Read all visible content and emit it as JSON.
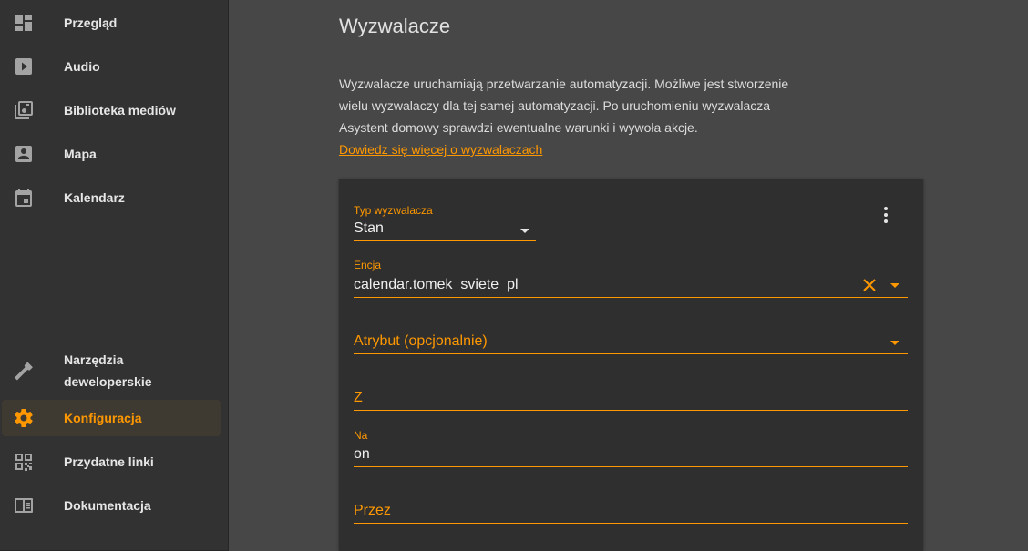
{
  "sidebar": {
    "items": [
      {
        "label": "Przegląd",
        "icon": "dashboard-icon",
        "active": false
      },
      {
        "label": "Audio",
        "icon": "play-box-icon",
        "active": false
      },
      {
        "label": "Biblioteka mediów",
        "icon": "music-library-icon",
        "active": false
      },
      {
        "label": "Mapa",
        "icon": "account-box-icon",
        "active": false
      },
      {
        "label": "Kalendarz",
        "icon": "calendar-icon",
        "active": false
      },
      {
        "label_line1": "Narzędzia",
        "label_line2": "deweloperskie",
        "icon": "hammer-icon",
        "active": false
      },
      {
        "label": "Konfiguracja",
        "icon": "cog-icon",
        "active": true
      },
      {
        "label": "Przydatne linki",
        "icon": "qrcode-icon",
        "active": false
      },
      {
        "label": "Dokumentacja",
        "icon": "book-icon",
        "active": false
      }
    ]
  },
  "main": {
    "title": "Wyzwalacze",
    "intro": {
      "line1": "Wyzwalacze uruchamiają przetwarzanie automatyzacji. Możliwe jest stworzenie",
      "line2": "wielu wyzwalaczy dla tej samej automatyzacji. Po uruchomieniu wyzwalacza",
      "line3": "Asystent domowy sprawdzi ewentualne warunki i wywoła akcje.",
      "link": "Dowiedz się więcej o wyzwalaczach"
    },
    "card": {
      "trigger_type": {
        "label": "Typ wyzwalacza",
        "value": "Stan"
      },
      "entity": {
        "label": "Encja",
        "value": "calendar.tomek_sviete_pl"
      },
      "attribute": {
        "placeholder": "Atrybut (opcjonalnie)"
      },
      "from": {
        "placeholder": "Z"
      },
      "to": {
        "label": "Na",
        "value": "on"
      },
      "for": {
        "placeholder": "Przez"
      }
    }
  },
  "colors": {
    "accent": "#ff9800",
    "sidebar_bg": "#323232",
    "main_bg": "#474747",
    "card_bg": "#2f2f2f"
  }
}
